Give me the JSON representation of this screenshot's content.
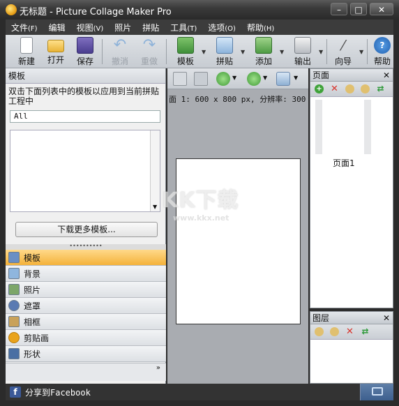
{
  "window": {
    "title": "无标题 - Picture Collage Maker Pro",
    "controls": {
      "minimize": "–",
      "maximize": "□",
      "close": "✕"
    }
  },
  "menu": [
    {
      "label": "文件",
      "key": "(F)"
    },
    {
      "label": "编辑",
      "key": ""
    },
    {
      "label": "视图",
      "key": "(V)"
    },
    {
      "label": "照片",
      "key": ""
    },
    {
      "label": "拼贴",
      "key": ""
    },
    {
      "label": "工具",
      "key": "(T)"
    },
    {
      "label": "选项",
      "key": "(O)"
    },
    {
      "label": "帮助",
      "key": "(H)"
    }
  ],
  "toolbar": {
    "new": "新建",
    "open": "打开",
    "save": "保存",
    "undo": "撤消",
    "redo": "重做",
    "template": "模板",
    "collage": "拼贴",
    "add": "添加",
    "output": "输出",
    "wizard": "向导",
    "help": "帮助"
  },
  "left_panel": {
    "header": "模板",
    "description": "双击下面列表中的模板以应用到当前拼贴工程中",
    "filter_value": "All",
    "more_button": "下载更多模板...",
    "nav": [
      {
        "label": "模板",
        "icon": "template-icon",
        "color": "#6a8fc4",
        "active": true
      },
      {
        "label": "背景",
        "icon": "background-icon",
        "color": "#8fb6de",
        "active": false
      },
      {
        "label": "照片",
        "icon": "photo-icon",
        "color": "#7ca66a",
        "active": false
      },
      {
        "label": "遮罩",
        "icon": "mask-icon",
        "color": "#5a7ab2",
        "active": false
      },
      {
        "label": "相框",
        "icon": "frame-icon",
        "color": "#c9a25a",
        "active": false
      },
      {
        "label": "剪贴画",
        "icon": "clipart-icon",
        "color": "#e9a31c",
        "active": false
      },
      {
        "label": "形状",
        "icon": "shape-icon",
        "color": "#4a6fa3",
        "active": false
      }
    ],
    "more_glyph": "»"
  },
  "center": {
    "page_info": "面 1: 600 x 800 px, 分辨率: 300"
  },
  "watermark": {
    "text": "KK下载",
    "url": "www.kkx.net"
  },
  "pages_panel": {
    "header": "页面",
    "close": "✕",
    "page_label": "页面1"
  },
  "layers_panel": {
    "header": "图层",
    "close": "✕"
  },
  "status": {
    "share": "分享到Facebook",
    "fb_letter": "f"
  }
}
